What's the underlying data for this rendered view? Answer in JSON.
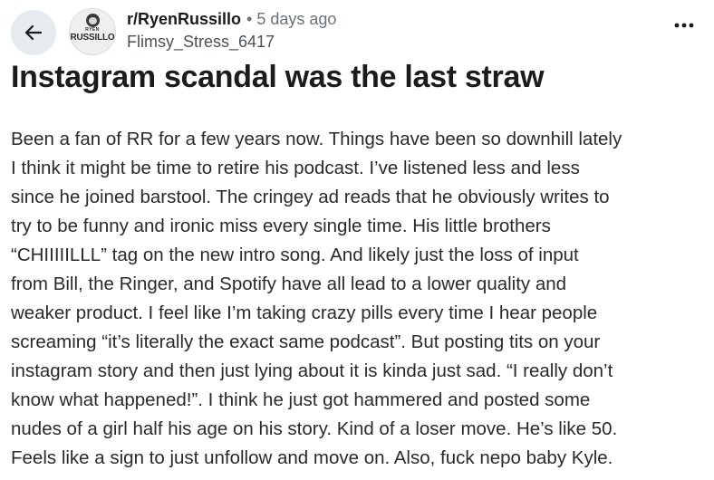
{
  "header": {
    "subreddit": "r/RyenRussillo",
    "separator": "•",
    "time_ago": "5 days ago",
    "author": "Flimsy_Stress_6417",
    "avatar_small_text": "RYEN",
    "avatar_text": "RUSSILLO"
  },
  "post": {
    "title": "Instagram scandal was the last straw",
    "body_lines": [
      "Been a fan of RR for a few years now. Things have been so downhill lately",
      "I think it might be time to retire his podcast. I’ve listened less and less",
      "since he joined barstool. The cringey ad reads that he obviously writes to",
      "try to be funny and ironic miss every single time. His little brothers",
      "“CHIIIIILLL” tag on the new intro song. And likely just the loss of input",
      "from Bill, the Ringer, and Spotify have all lead to a lower quality and",
      "weaker product. I feel like I’m taking crazy pills every time I hear people",
      "screaming “it’s literally the exact same podcast”. But posting tits on your",
      "instagram story and then just lying about it is kinda just sad. “I really don’t",
      "know what happened!”. I think he just got hammered and posted some",
      "nudes of a girl half his age on his story. Kind of a loser move. He’s like 50.",
      "Feels like a sign to just unfollow and move on. Also, fuck nepo baby Kyle."
    ]
  },
  "icons": {
    "back": "arrow-left-icon",
    "more": "more-horizontal-icon"
  },
  "colors": {
    "back_button_bg": "#e5ebee",
    "meta_text": "#6b7378",
    "text": "#1c1c1c"
  }
}
